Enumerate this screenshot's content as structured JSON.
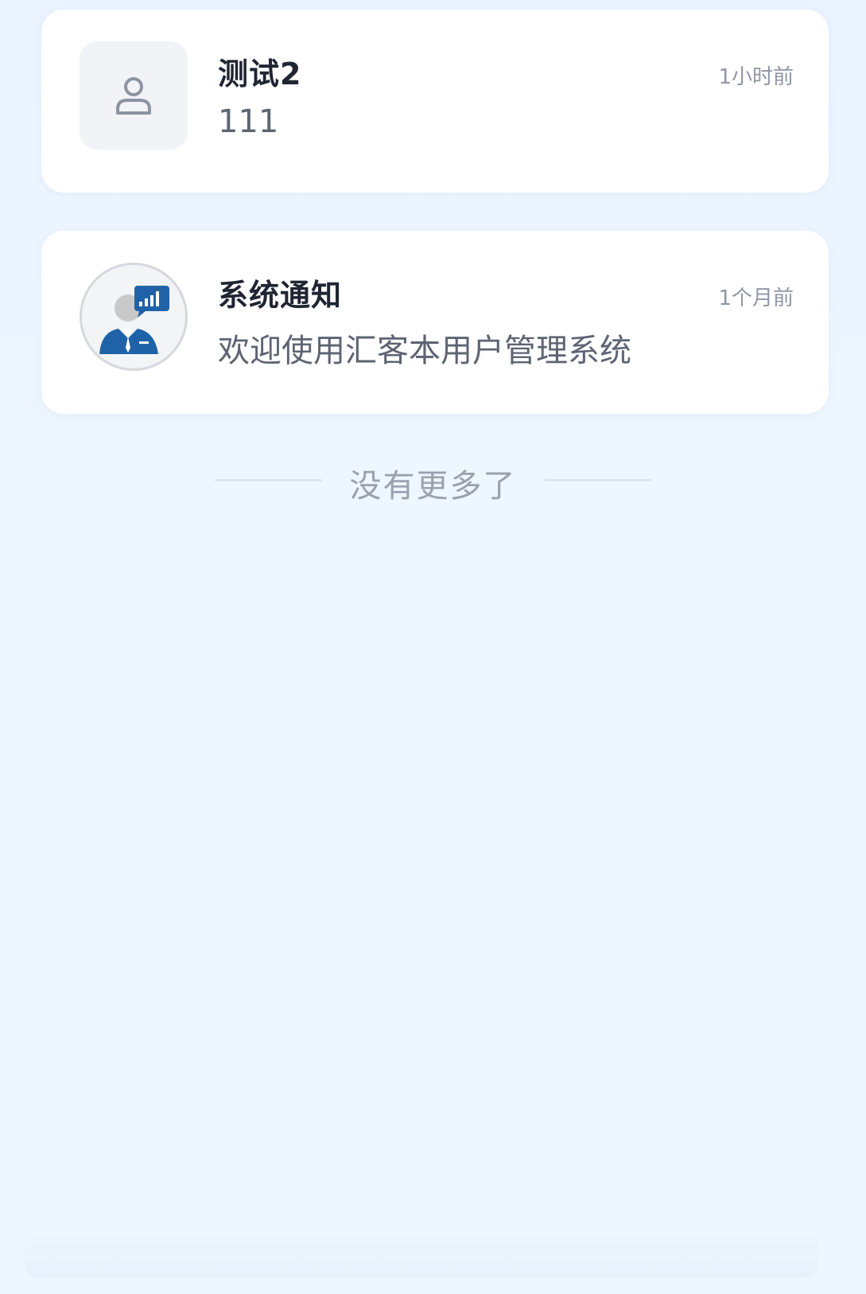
{
  "notifications": [
    {
      "title": "测试2",
      "content": "111",
      "time": "1小时前",
      "avatar": "user-placeholder-icon"
    },
    {
      "title": "系统通知",
      "content": "欢迎使用汇客本用户管理系统",
      "time": "1个月前",
      "avatar": "system-avatar-icon"
    }
  ],
  "list_end_text": "没有更多了",
  "colors": {
    "background": "#eef6ff",
    "card": "#ffffff",
    "title": "#1f2532",
    "muted": "#8f96a3",
    "brand_blue": "#1f62a8"
  }
}
